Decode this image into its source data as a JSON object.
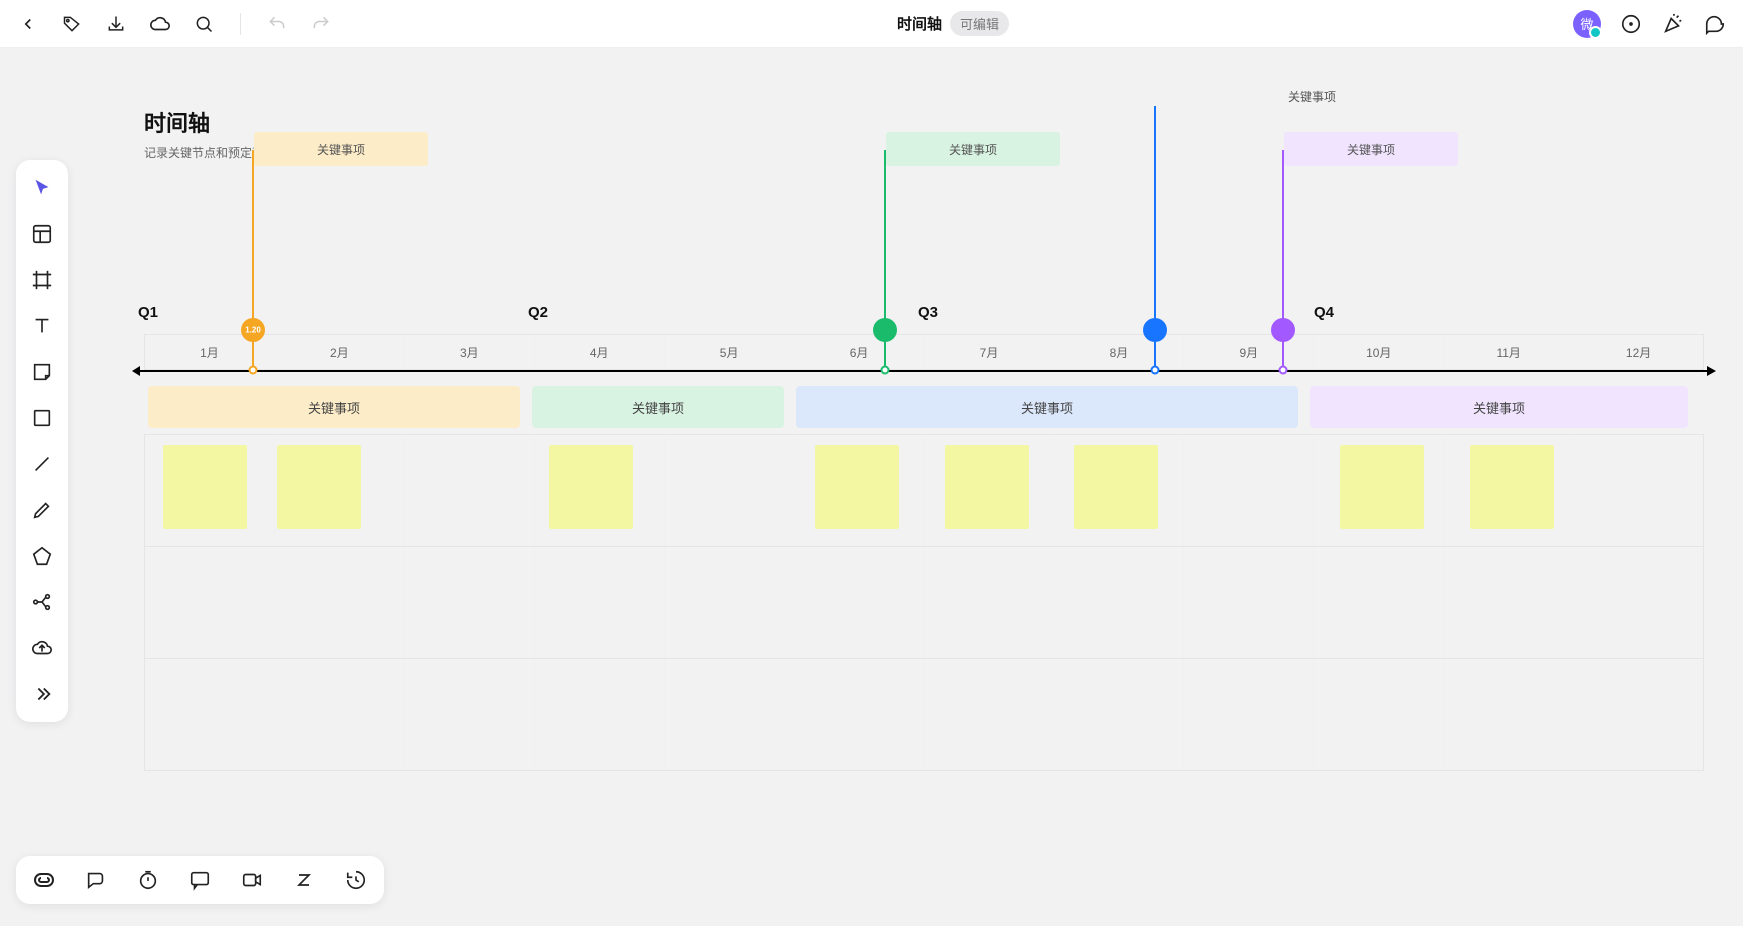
{
  "header": {
    "title": "时间轴",
    "badge": "可编辑",
    "avatar_letter": "微"
  },
  "canvas": {
    "title": "时间轴",
    "subtitle": "记录关键节点和预定事件的时间顺序"
  },
  "timeline": {
    "quarters": [
      "Q1",
      "Q2",
      "Q3",
      "Q4"
    ],
    "months": [
      "1月",
      "2月",
      "3月",
      "4月",
      "5月",
      "6月",
      "7月",
      "8月",
      "9月",
      "10月",
      "11月",
      "12月"
    ],
    "markers": [
      {
        "color": "orange",
        "flag_label": "关键事项",
        "dot_label": "1.20"
      },
      {
        "color": "green",
        "flag_label": "关键事项"
      },
      {
        "color": "blue",
        "top_label": "关键事项"
      },
      {
        "color": "purple",
        "flag_label": "关键事项"
      }
    ],
    "banners": [
      {
        "style": "orange",
        "label": "关键事项"
      },
      {
        "style": "green",
        "label": "关键事项"
      },
      {
        "style": "blue",
        "label": "关键事项"
      },
      {
        "style": "purple",
        "label": "关键事项"
      }
    ],
    "notes_layout": [
      [
        2,
        0,
        1,
        0,
        1,
        1,
        1,
        0,
        1,
        1,
        0,
        0
      ],
      [
        0,
        0,
        0,
        0,
        0,
        0,
        0,
        0,
        0,
        0,
        0,
        0
      ],
      [
        0,
        0,
        0,
        0,
        0,
        0,
        0,
        0,
        0,
        0,
        0,
        0
      ]
    ]
  }
}
